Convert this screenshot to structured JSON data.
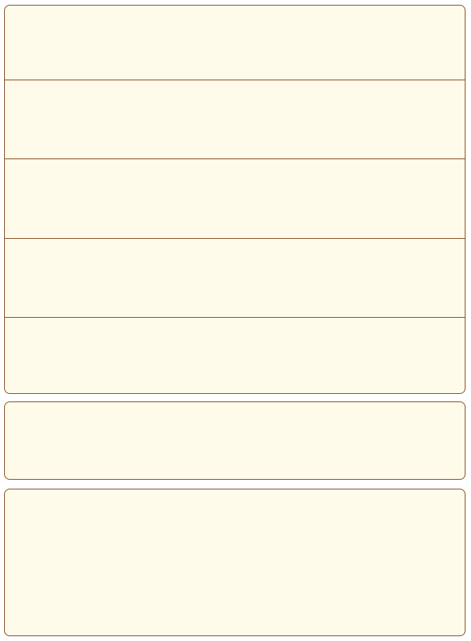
{
  "panels": {
    "main": {
      "rows": [
        {
          "text": ""
        },
        {
          "text": ""
        },
        {
          "text": ""
        },
        {
          "text": ""
        },
        {
          "text": ""
        }
      ]
    },
    "middle": {
      "text": ""
    },
    "bottom": {
      "text": ""
    }
  }
}
